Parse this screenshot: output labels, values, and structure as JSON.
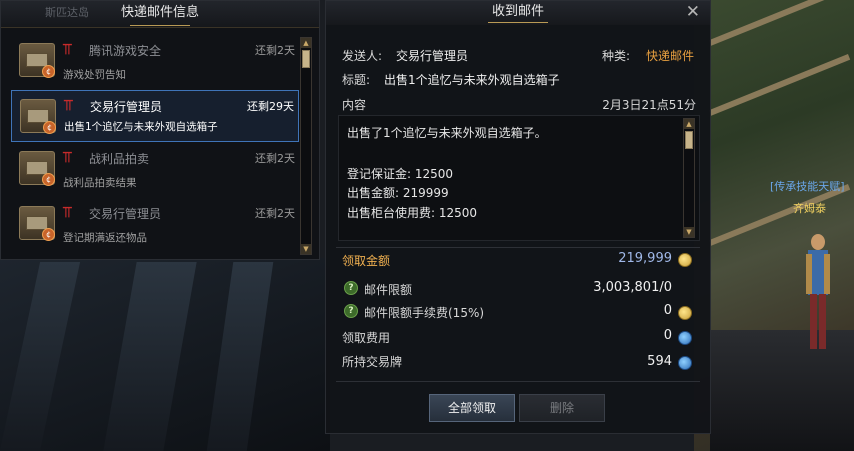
{
  "left_panel": {
    "title": "快递邮件信息",
    "ghost_text": "斯匹达岛",
    "mails": [
      {
        "sender": "腾讯游戏安全",
        "days": "还剩2天",
        "subject": "游戏处罚告知",
        "selected": false
      },
      {
        "sender": "交易行管理员",
        "days": "还剩29天",
        "subject": "出售1个追忆与未来外观自选箱子",
        "selected": true
      },
      {
        "sender": "战利品拍卖",
        "days": "还剩2天",
        "subject": "战利品拍卖结果",
        "selected": false
      },
      {
        "sender": "交易行管理员",
        "days": "还剩2天",
        "subject": "登记期满返还物品",
        "selected": false
      }
    ]
  },
  "detail_panel": {
    "title": "收到邮件",
    "close_icon": "close-icon",
    "sender_label": "发送人:",
    "sender_value": "交易行管理员",
    "type_label": "种类:",
    "type_value": "快递邮件",
    "subject_label": "标题:",
    "subject_value": "出售1个追忆与未来外观自选箱子",
    "content_label": "内容",
    "date": "2月3日21点51分",
    "content_lines": [
      "出售了1个追忆与未来外观自选箱子。",
      "",
      "登记保证金: 12500",
      "出售金额: 219999",
      "出售柜台使用费: 12500"
    ],
    "claim_label": "领取金额",
    "claim_value": "219,999",
    "limit_label": "邮件限额",
    "limit_value": "3,003,801/0",
    "fee_label": "邮件限额手续费(15%)",
    "fee_value": "0",
    "collect_fee_label": "领取费用",
    "collect_fee_value": "0",
    "tokens_label": "所持交易牌",
    "tokens_value": "594",
    "claim_all_button": "全部领取",
    "delete_button": "删除"
  },
  "scene": {
    "skill_label": "[传承技能天赋]",
    "npc_name": "齐姆泰"
  },
  "colors": {
    "accent_orange": "#e8a040",
    "claim_orange": "#f0b050",
    "claim_value_blue": "#a0b8e8",
    "selection_border": "#3f74b8"
  }
}
